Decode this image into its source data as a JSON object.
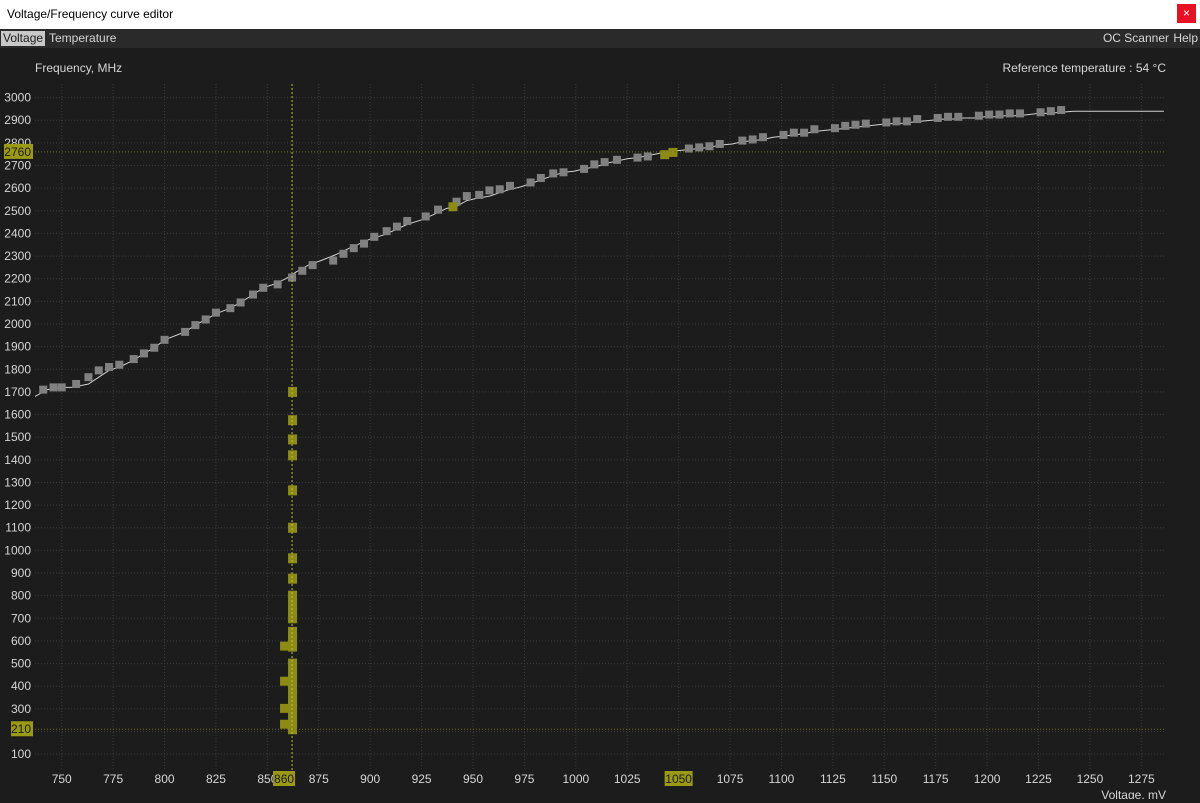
{
  "window": {
    "title": "Voltage/Frequency curve editor",
    "close_label": "×"
  },
  "menu": {
    "voltage": "Voltage",
    "temperature": "Temperature",
    "oc_scanner": "OC Scanner",
    "help": "Help"
  },
  "colors": {
    "background": "#1c1c1c",
    "grid": "#3a3a3a",
    "point": "#808080",
    "highlight": "#8c8c14",
    "label_bg": "#9a9a14",
    "curve": "#d0d0d0"
  },
  "chart_data": {
    "type": "scatter",
    "ylabel": "Frequency, MHz",
    "xlabel": "Voltage, mV",
    "reference_temperature": "Reference temperature : 54 °C",
    "xlim": [
      737,
      1287
    ],
    "ylim": [
      30,
      3060
    ],
    "xticks": [
      750,
      775,
      800,
      825,
      850,
      875,
      900,
      925,
      950,
      975,
      1000,
      1025,
      1050,
      1075,
      1100,
      1125,
      1150,
      1175,
      1200,
      1225,
      1250,
      1275
    ],
    "yticks": [
      100,
      200,
      300,
      400,
      500,
      600,
      700,
      800,
      900,
      1000,
      1100,
      1200,
      1300,
      1400,
      1500,
      1600,
      1700,
      1800,
      1900,
      2000,
      2100,
      2200,
      2300,
      2400,
      2500,
      2600,
      2700,
      2800,
      2900,
      3000
    ],
    "highlight_x": {
      "value": 862,
      "label": "860"
    },
    "highlight_x2": {
      "value": 1050,
      "label": "1050"
    },
    "highlight_y_top": {
      "value": 2760,
      "label": "2760"
    },
    "highlight_y_bottom": {
      "value": 210,
      "label": "210"
    },
    "curve": {
      "x": [
        737,
        743,
        750,
        755,
        763,
        768,
        773,
        778,
        785,
        790,
        795,
        800,
        810,
        815,
        820,
        825,
        832,
        837,
        843,
        848,
        853,
        859,
        864,
        870,
        876,
        883,
        890,
        895,
        900,
        907,
        912,
        918,
        925,
        930,
        937,
        942,
        947,
        952,
        958,
        963,
        968,
        973,
        978,
        984,
        989,
        994,
        999,
        1004,
        1010,
        1015,
        1020,
        1025,
        1030,
        1036,
        1041,
        1045,
        1049,
        1054,
        1060,
        1065,
        1070,
        1076,
        1081,
        1086,
        1091,
        1096,
        1101,
        1106,
        1111,
        1116,
        1121,
        1127,
        1132,
        1137,
        1142,
        1147,
        1152,
        1157,
        1162,
        1167,
        1173,
        1178,
        1183,
        1188,
        1194,
        1199,
        1204,
        1209,
        1214,
        1220,
        1225,
        1230,
        1236,
        1242,
        1247,
        1252,
        1257,
        1263,
        1268,
        1273,
        1278,
        1283,
        1286
      ],
      "y": [
        1680,
        1710,
        1720,
        1720,
        1735,
        1765,
        1795,
        1810,
        1840,
        1870,
        1895,
        1930,
        1965,
        1995,
        2020,
        2045,
        2070,
        2095,
        2130,
        2160,
        2175,
        2200,
        2230,
        2260,
        2280,
        2305,
        2335,
        2355,
        2375,
        2395,
        2415,
        2440,
        2460,
        2480,
        2510,
        2520,
        2545,
        2555,
        2565,
        2580,
        2595,
        2605,
        2620,
        2640,
        2655,
        2670,
        2675,
        2685,
        2695,
        2710,
        2720,
        2730,
        2735,
        2745,
        2755,
        2755,
        2765,
        2770,
        2775,
        2780,
        2790,
        2795,
        2805,
        2810,
        2815,
        2825,
        2830,
        2835,
        2840,
        2850,
        2855,
        2860,
        2865,
        2870,
        2875,
        2880,
        2885,
        2885,
        2890,
        2895,
        2900,
        2905,
        2905,
        2910,
        2910,
        2915,
        2915,
        2920,
        2920,
        2925,
        2930,
        2930,
        2935,
        2940,
        2940,
        2940,
        2940,
        2940,
        2940,
        2940,
        2940,
        2940,
        2940
      ]
    },
    "points": [
      {
        "x": 741,
        "y": 1710
      },
      {
        "x": 746,
        "y": 1720
      },
      {
        "x": 750,
        "y": 1720
      },
      {
        "x": 757,
        "y": 1735
      },
      {
        "x": 763,
        "y": 1765
      },
      {
        "x": 768,
        "y": 1795
      },
      {
        "x": 773,
        "y": 1810
      },
      {
        "x": 778,
        "y": 1820
      },
      {
        "x": 785,
        "y": 1845
      },
      {
        "x": 790,
        "y": 1870
      },
      {
        "x": 795,
        "y": 1895
      },
      {
        "x": 800,
        "y": 1930
      },
      {
        "x": 810,
        "y": 1965
      },
      {
        "x": 815,
        "y": 1995
      },
      {
        "x": 820,
        "y": 2020
      },
      {
        "x": 825,
        "y": 2050
      },
      {
        "x": 832,
        "y": 2070
      },
      {
        "x": 837,
        "y": 2095
      },
      {
        "x": 843,
        "y": 2130
      },
      {
        "x": 848,
        "y": 2160
      },
      {
        "x": 855,
        "y": 2175
      },
      {
        "x": 862,
        "y": 2205
      },
      {
        "x": 867,
        "y": 2235
      },
      {
        "x": 872,
        "y": 2260
      },
      {
        "x": 882,
        "y": 2280
      },
      {
        "x": 887,
        "y": 2310
      },
      {
        "x": 892,
        "y": 2335
      },
      {
        "x": 897,
        "y": 2355
      },
      {
        "x": 902,
        "y": 2385
      },
      {
        "x": 908,
        "y": 2410
      },
      {
        "x": 913,
        "y": 2430
      },
      {
        "x": 918,
        "y": 2455
      },
      {
        "x": 927,
        "y": 2475
      },
      {
        "x": 933,
        "y": 2505
      },
      {
        "x": 942,
        "y": 2540
      },
      {
        "x": 947,
        "y": 2565
      },
      {
        "x": 953,
        "y": 2570
      },
      {
        "x": 958,
        "y": 2590
      },
      {
        "x": 963,
        "y": 2595
      },
      {
        "x": 968,
        "y": 2610
      },
      {
        "x": 978,
        "y": 2625
      },
      {
        "x": 983,
        "y": 2645
      },
      {
        "x": 989,
        "y": 2665
      },
      {
        "x": 994,
        "y": 2670
      },
      {
        "x": 1004,
        "y": 2685
      },
      {
        "x": 1009,
        "y": 2705
      },
      {
        "x": 1014,
        "y": 2715
      },
      {
        "x": 1020,
        "y": 2725
      },
      {
        "x": 1030,
        "y": 2735
      },
      {
        "x": 1035,
        "y": 2740
      },
      {
        "x": 1055,
        "y": 2775
      },
      {
        "x": 1060,
        "y": 2780
      },
      {
        "x": 1065,
        "y": 2785
      },
      {
        "x": 1070,
        "y": 2795
      },
      {
        "x": 1081,
        "y": 2810
      },
      {
        "x": 1086,
        "y": 2815
      },
      {
        "x": 1091,
        "y": 2825
      },
      {
        "x": 1101,
        "y": 2835
      },
      {
        "x": 1106,
        "y": 2845
      },
      {
        "x": 1111,
        "y": 2845
      },
      {
        "x": 1116,
        "y": 2860
      },
      {
        "x": 1126,
        "y": 2865
      },
      {
        "x": 1131,
        "y": 2875
      },
      {
        "x": 1136,
        "y": 2880
      },
      {
        "x": 1141,
        "y": 2885
      },
      {
        "x": 1151,
        "y": 2890
      },
      {
        "x": 1156,
        "y": 2895
      },
      {
        "x": 1161,
        "y": 2895
      },
      {
        "x": 1166,
        "y": 2905
      },
      {
        "x": 1176,
        "y": 2910
      },
      {
        "x": 1181,
        "y": 2915
      },
      {
        "x": 1186,
        "y": 2915
      },
      {
        "x": 1196,
        "y": 2920
      },
      {
        "x": 1201,
        "y": 2925
      },
      {
        "x": 1206,
        "y": 2925
      },
      {
        "x": 1211,
        "y": 2930
      },
      {
        "x": 1216,
        "y": 2930
      },
      {
        "x": 1226,
        "y": 2935
      },
      {
        "x": 1231,
        "y": 2940
      },
      {
        "x": 1236,
        "y": 2945
      }
    ],
    "highlighted_points": [
      {
        "x": 940,
        "y": 2520
      },
      {
        "x": 1043,
        "y": 2750
      },
      {
        "x": 1047,
        "y": 2760
      }
    ],
    "column_points": {
      "x": 862,
      "y": [
        1700,
        1575,
        1490,
        1420,
        1265,
        1100,
        965,
        875,
        800,
        760,
        730,
        700,
        640,
        610,
        575,
        500,
        460,
        420,
        390,
        360,
        330,
        300,
        260,
        230,
        210
      ],
      "side_x": 860,
      "side_y": [
        575,
        420,
        300,
        230
      ]
    }
  }
}
